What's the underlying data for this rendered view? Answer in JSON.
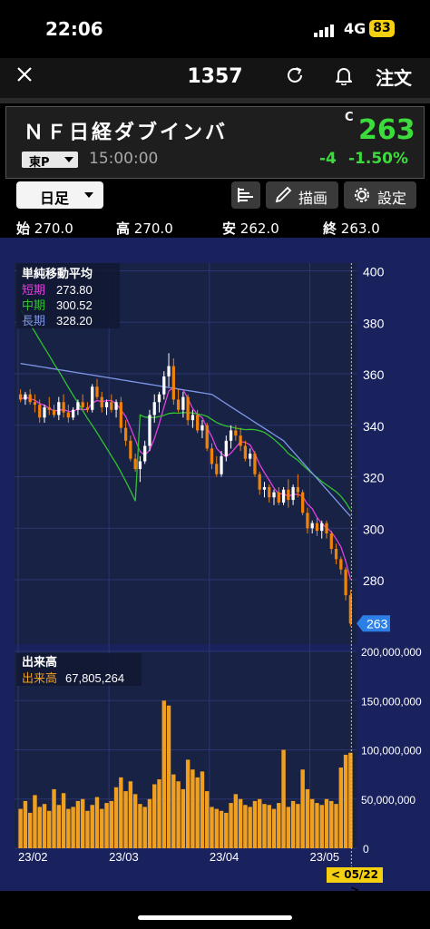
{
  "status": {
    "time": "22:06",
    "network": "4G",
    "battery": "83"
  },
  "nav": {
    "title": "1357",
    "order_label": "注文",
    "icons": [
      "close-icon",
      "refresh-icon",
      "bell-icon"
    ]
  },
  "quote": {
    "name": "ＮＦ日経ダブインバ",
    "current_marker": "C",
    "price": "263",
    "market": "東P",
    "time": "15:00:00",
    "change": "-4",
    "change_pct": "-1.50%",
    "colors": {
      "up_text": "#3cdc3c"
    }
  },
  "toolbar": {
    "period": "日足",
    "draw_label": "描画",
    "settings_label": "設定"
  },
  "ohlc": {
    "open_label": "始",
    "open": "270.0",
    "high_label": "高",
    "high": "270.0",
    "low_label": "安",
    "low": "262.0",
    "close_label": "終",
    "close": "263.0"
  },
  "chart_data": {
    "type": "candlestick",
    "price_axis": {
      "ticks": [
        "400",
        "380",
        "360",
        "340",
        "320",
        "300",
        "280"
      ],
      "range": [
        255,
        403
      ]
    },
    "volume_axis": {
      "ticks": [
        "200,000,000",
        "150,000,000",
        "100,000,000",
        "50,000,000",
        "0"
      ],
      "range": [
        0,
        200000000
      ]
    },
    "x_labels": [
      "23/02",
      "23/03",
      "23/04",
      "23/05"
    ],
    "current_price_badge": "263",
    "cursor_date_badge": "< 05/22 >",
    "ma_legend": {
      "title": "単純移動平均",
      "items": [
        {
          "name": "短期",
          "value": "273.80",
          "color": "#e040e0"
        },
        {
          "name": "中期",
          "value": "300.52",
          "color": "#30c030"
        },
        {
          "name": "長期",
          "value": "328.20",
          "color": "#7f96e6"
        }
      ]
    },
    "volume_legend": {
      "title": "出来高",
      "name": "出来高",
      "value": "67,805,264",
      "color": "#f0a020"
    },
    "colors": {
      "up": "#ffffff",
      "down": "#f0820a",
      "volume": "#f0a020",
      "grid": "#2c3570"
    },
    "candles": [
      [
        352,
        354,
        349,
        350
      ],
      [
        350,
        353,
        348,
        352
      ],
      [
        352,
        354,
        348,
        349
      ],
      [
        349,
        352,
        345,
        348
      ],
      [
        348,
        350,
        341,
        343
      ],
      [
        343,
        348,
        341,
        347
      ],
      [
        347,
        351,
        344,
        346
      ],
      [
        346,
        348,
        343,
        344
      ],
      [
        344,
        351,
        342,
        349
      ],
      [
        349,
        352,
        343,
        345
      ],
      [
        345,
        348,
        341,
        343
      ],
      [
        343,
        347,
        342,
        346
      ],
      [
        346,
        350,
        344,
        349
      ],
      [
        349,
        352,
        346,
        347
      ],
      [
        347,
        349,
        345,
        346
      ],
      [
        346,
        356,
        345,
        355
      ],
      [
        355,
        358,
        350,
        351
      ],
      [
        351,
        353,
        345,
        347
      ],
      [
        347,
        350,
        344,
        349
      ],
      [
        349,
        352,
        345,
        346
      ],
      [
        346,
        350,
        343,
        349
      ],
      [
        349,
        351,
        337,
        339
      ],
      [
        339,
        342,
        332,
        334
      ],
      [
        334,
        336,
        326,
        327
      ],
      [
        327,
        329,
        322,
        323
      ],
      [
        323,
        328,
        318,
        326
      ],
      [
        326,
        334,
        325,
        332
      ],
      [
        332,
        346,
        330,
        344
      ],
      [
        344,
        352,
        341,
        349
      ],
      [
        349,
        353,
        345,
        352
      ],
      [
        352,
        361,
        350,
        359
      ],
      [
        359,
        368,
        355,
        363
      ],
      [
        363,
        366,
        348,
        350
      ],
      [
        350,
        354,
        345,
        346
      ],
      [
        346,
        353,
        343,
        351
      ],
      [
        351,
        352,
        340,
        342
      ],
      [
        342,
        346,
        339,
        344
      ],
      [
        344,
        346,
        337,
        338
      ],
      [
        338,
        342,
        335,
        340
      ],
      [
        340,
        341,
        330,
        331
      ],
      [
        331,
        333,
        323,
        325
      ],
      [
        325,
        328,
        320,
        321
      ],
      [
        321,
        330,
        320,
        328
      ],
      [
        328,
        336,
        326,
        334
      ],
      [
        334,
        340,
        331,
        338
      ],
      [
        338,
        340,
        334,
        336
      ],
      [
        336,
        339,
        330,
        332
      ],
      [
        332,
        334,
        326,
        327
      ],
      [
        327,
        331,
        324,
        329
      ],
      [
        329,
        330,
        320,
        321
      ],
      [
        321,
        322,
        313,
        315
      ],
      [
        315,
        318,
        312,
        316
      ],
      [
        316,
        317,
        310,
        312
      ],
      [
        312,
        315,
        309,
        314
      ],
      [
        314,
        316,
        309,
        310
      ],
      [
        310,
        316,
        309,
        315
      ],
      [
        315,
        319,
        308,
        311
      ],
      [
        311,
        317,
        309,
        316
      ],
      [
        316,
        321,
        312,
        314
      ],
      [
        314,
        315,
        305,
        306
      ],
      [
        306,
        308,
        298,
        300
      ],
      [
        300,
        303,
        298,
        302
      ],
      [
        302,
        304,
        297,
        299
      ],
      [
        299,
        303,
        296,
        302
      ],
      [
        302,
        303,
        296,
        298
      ],
      [
        298,
        299,
        290,
        292
      ],
      [
        292,
        294,
        286,
        288
      ],
      [
        288,
        289,
        282,
        284
      ],
      [
        284,
        285,
        272,
        274
      ],
      [
        274,
        276,
        262,
        263
      ]
    ],
    "volume": [
      40,
      48,
      36,
      54,
      42,
      45,
      38,
      60,
      44,
      56,
      40,
      42,
      48,
      50,
      38,
      44,
      52,
      40,
      46,
      48,
      62,
      72,
      58,
      68,
      55,
      45,
      42,
      50,
      65,
      70,
      150,
      145,
      75,
      68,
      60,
      90,
      80,
      72,
      78,
      58,
      42,
      40,
      38,
      36,
      46,
      55,
      50,
      44,
      42,
      48,
      50,
      45,
      44,
      40,
      46,
      100,
      42,
      48,
      45,
      80,
      60,
      50,
      46,
      44,
      50,
      48,
      45,
      82,
      95,
      97
    ]
  }
}
